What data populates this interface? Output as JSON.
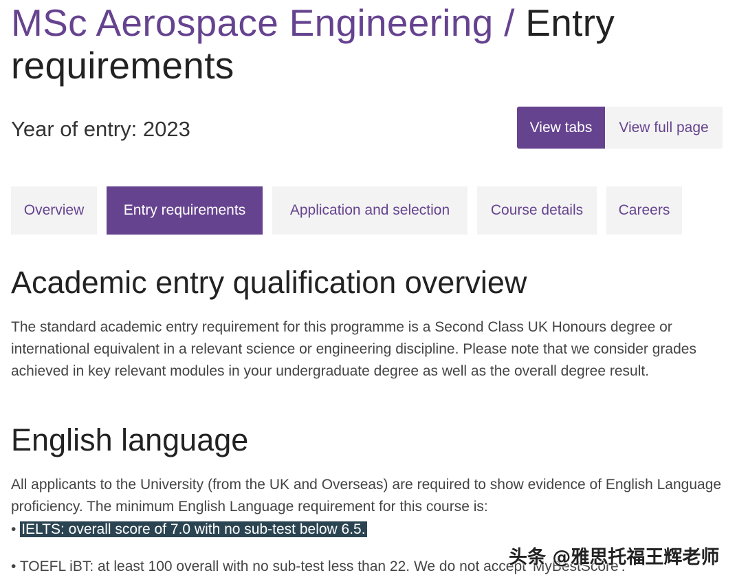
{
  "header": {
    "crumb": "MSc Aerospace Engineering",
    "separator": " / ",
    "title": "Entry requirements"
  },
  "year_of_entry": "Year of entry: 2023",
  "view_toggle": {
    "view_tabs": "View tabs",
    "view_full_page": "View full page"
  },
  "tabs": [
    {
      "label": "Overview",
      "active": false
    },
    {
      "label": "Entry requirements",
      "active": true
    },
    {
      "label": "Application and selection",
      "active": false
    },
    {
      "label": "Course details",
      "active": false
    },
    {
      "label": "Careers",
      "active": false
    }
  ],
  "academic": {
    "heading": "Academic entry qualification overview",
    "body": "The standard academic entry requirement for this programme is a Second Class UK Honours degree or international equivalent in a relevant science or engineering discipline.  Please note that we consider grades achieved in key relevant modules in your undergraduate degree as well as the overall degree result."
  },
  "english": {
    "heading": "English language",
    "body": "All applicants to the University (from the UK and Overseas) are required to show evidence of English Language proficiency. The minimum English Language requirement for this course is:",
    "bullet_char": "•",
    "ielts": "IELTS: overall score of 7.0 with no sub-test below 6.5.",
    "toefl": "TOEFL iBT: at least 100 overall with no sub-test less than 22. We do not accept 'MyBestScore'."
  },
  "watermark": "头条 @雅思托福王辉老师",
  "colors": {
    "brand_purple": "#66438f",
    "highlight_bg": "#2b4451",
    "tab_bg": "#f3f3f3"
  }
}
